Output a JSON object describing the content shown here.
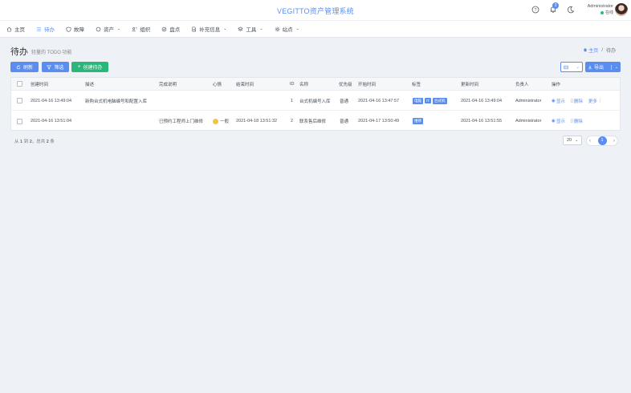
{
  "app": {
    "title": "VEGITTO资产管理系统"
  },
  "topbar": {
    "notification_count": "3",
    "user_name": "Administrator",
    "user_status": "在线"
  },
  "nav": [
    {
      "label": "主页",
      "icon": "home-icon"
    },
    {
      "label": "待办",
      "icon": "list-icon"
    },
    {
      "label": "故障",
      "icon": "shield-icon"
    },
    {
      "label": "资产",
      "icon": "circle-icon",
      "caret": "⌄"
    },
    {
      "label": "组织",
      "icon": "users-icon"
    },
    {
      "label": "盘点",
      "icon": "check-circle-icon"
    },
    {
      "label": "补充信息",
      "icon": "file-icon",
      "caret": "⌄"
    },
    {
      "label": "工具",
      "icon": "layers-icon",
      "caret": "⌄"
    },
    {
      "label": "站点",
      "icon": "gear-icon",
      "caret": "⌄"
    }
  ],
  "page": {
    "title": "待办",
    "subtitle": "轻量的 TODO 功能"
  },
  "breadcrumb": {
    "home": "主页",
    "sep": "/",
    "current": "待办"
  },
  "toolbar": {
    "refresh": "刷新",
    "filter": "筛选",
    "create": "创建待办",
    "export": "导出"
  },
  "table": {
    "columns": {
      "created": "创建时间",
      "desc": "描述",
      "done_note": "完成说明",
      "mood": "心情",
      "end": "结束时间",
      "id": "ID",
      "name": "名称",
      "priority": "优先级",
      "start": "开始时间",
      "tags": "标签",
      "updated": "更新时间",
      "owner": "负责人",
      "actions": "操作"
    },
    "rows": [
      {
        "created": "2021-04-16 13:49:04",
        "desc": "新购台式机电脑编号和配置入库",
        "done_note": "",
        "mood": "",
        "end": "",
        "id": "1",
        "name": "台式机编号入库",
        "priority": "普通",
        "start": "2021-04-16 13:47:57",
        "tags": [
          "电脑",
          "IT",
          "台式机"
        ],
        "updated": "2021-04-16 13:49:04",
        "owner": "Administrator",
        "show": "显示",
        "delete": "删除",
        "more": "更多"
      },
      {
        "created": "2021-04-16 13:51:04",
        "desc": "",
        "done_note": "已预约工程师上门维修",
        "mood": "一般",
        "end": "2021-04-18 13:51:32",
        "id": "2",
        "name": "联系售后维修",
        "priority": "普通",
        "start": "2021-04-17 13:50:49",
        "tags": [
          "维修"
        ],
        "updated": "2021-04-16 13:51:55",
        "owner": "Administrator",
        "show": "显示",
        "delete": "删除",
        "more": ""
      }
    ]
  },
  "footer": {
    "summary_prefix": "从",
    "from": "1",
    "to_word": "到",
    "to": "2",
    "total_word": "，总共",
    "total": "2",
    "unit": "条",
    "page_size": "20",
    "current_page": "1",
    "prev": "‹",
    "next": "›"
  }
}
